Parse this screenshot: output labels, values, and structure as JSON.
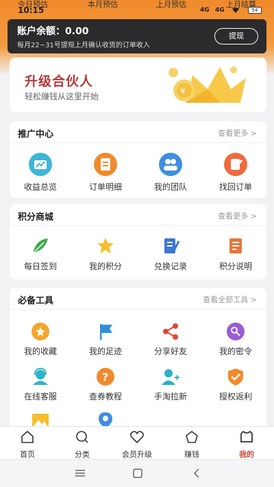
{
  "status_bar": {
    "time": "10:15",
    "labels": [
      "今日预估",
      "本月预估",
      "上月预估",
      "上月结算"
    ],
    "signal_left": "4G",
    "signal_right": "4G",
    "battery": "54"
  },
  "balance": {
    "amount_text": "账户余额：0.00",
    "note": "每月22~31号提现上月确认收货的订单收入",
    "withdraw_label": "提现"
  },
  "banner": {
    "title": "升级合伙人",
    "subtitle": "轻松赚钱从这里开始"
  },
  "promo": {
    "title": "推广中心",
    "more": "查看更多 >",
    "items": [
      {
        "label": "收益总览",
        "icon": "chart-icon"
      },
      {
        "label": "订单明细",
        "icon": "order-list-icon"
      },
      {
        "label": "我的团队",
        "icon": "team-icon"
      },
      {
        "label": "找回订单",
        "icon": "recover-order-icon"
      }
    ]
  },
  "points": {
    "title": "积分商城",
    "more": "查看更多 >",
    "items": [
      {
        "label": "每日签到",
        "icon": "feather-icon"
      },
      {
        "label": "我的积分",
        "icon": "star-icon"
      },
      {
        "label": "兑换记录",
        "icon": "notebook-icon"
      },
      {
        "label": "积分说明",
        "icon": "document-icon"
      }
    ]
  },
  "tools": {
    "title": "必备工具",
    "more": "查看全部工具 >",
    "items": [
      {
        "label": "我的收藏",
        "icon": "favorite-star-icon"
      },
      {
        "label": "我的足迹",
        "icon": "flag-icon"
      },
      {
        "label": "分享好友",
        "icon": "share-icon"
      },
      {
        "label": "我的密令",
        "icon": "key-icon"
      },
      {
        "label": "在线客服",
        "icon": "customer-service-icon"
      },
      {
        "label": "查券教程",
        "icon": "help-icon"
      },
      {
        "label": "手淘拉新",
        "icon": "add-user-icon"
      },
      {
        "label": "授权返利",
        "icon": "shield-check-icon"
      }
    ]
  },
  "tabbar": {
    "items": [
      {
        "label": "首页",
        "icon": "home-icon"
      },
      {
        "label": "分类",
        "icon": "search-icon"
      },
      {
        "label": "会员升级",
        "icon": "heart-icon"
      },
      {
        "label": "赚钱",
        "icon": "pentagon-icon"
      },
      {
        "label": "我的",
        "icon": "profile-icon"
      }
    ],
    "active_index": 4
  },
  "colors": {
    "accent": "#f08a2c",
    "active_tab": "#d2473a",
    "card_dark": "#2b2b2d"
  }
}
